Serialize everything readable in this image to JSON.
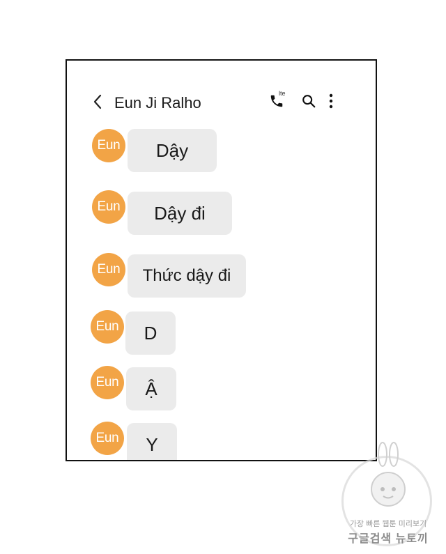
{
  "header": {
    "contact_name": "Eun Ji Ralho",
    "call_badge": "lte"
  },
  "icons": {
    "back": "chevron-left-icon",
    "call": "phone-call-icon",
    "search": "search-icon",
    "more": "more-vertical-icon"
  },
  "colors": {
    "avatar": "#f2a446",
    "bubble": "#ebebeb"
  },
  "messages": [
    {
      "sender": "Eun",
      "text": "Dậy"
    },
    {
      "sender": "Eun",
      "text": "Dậy đi"
    },
    {
      "sender": "Eun",
      "text": "Thức dậy đi"
    },
    {
      "sender": "Eun",
      "text": "D"
    },
    {
      "sender": "Eun",
      "text": "Ậ"
    },
    {
      "sender": "Eun",
      "text": "Y"
    }
  ],
  "watermark": {
    "line1": "가장 빠른 웹툰 미리보기",
    "line2": "구글검색 뉴토끼"
  }
}
